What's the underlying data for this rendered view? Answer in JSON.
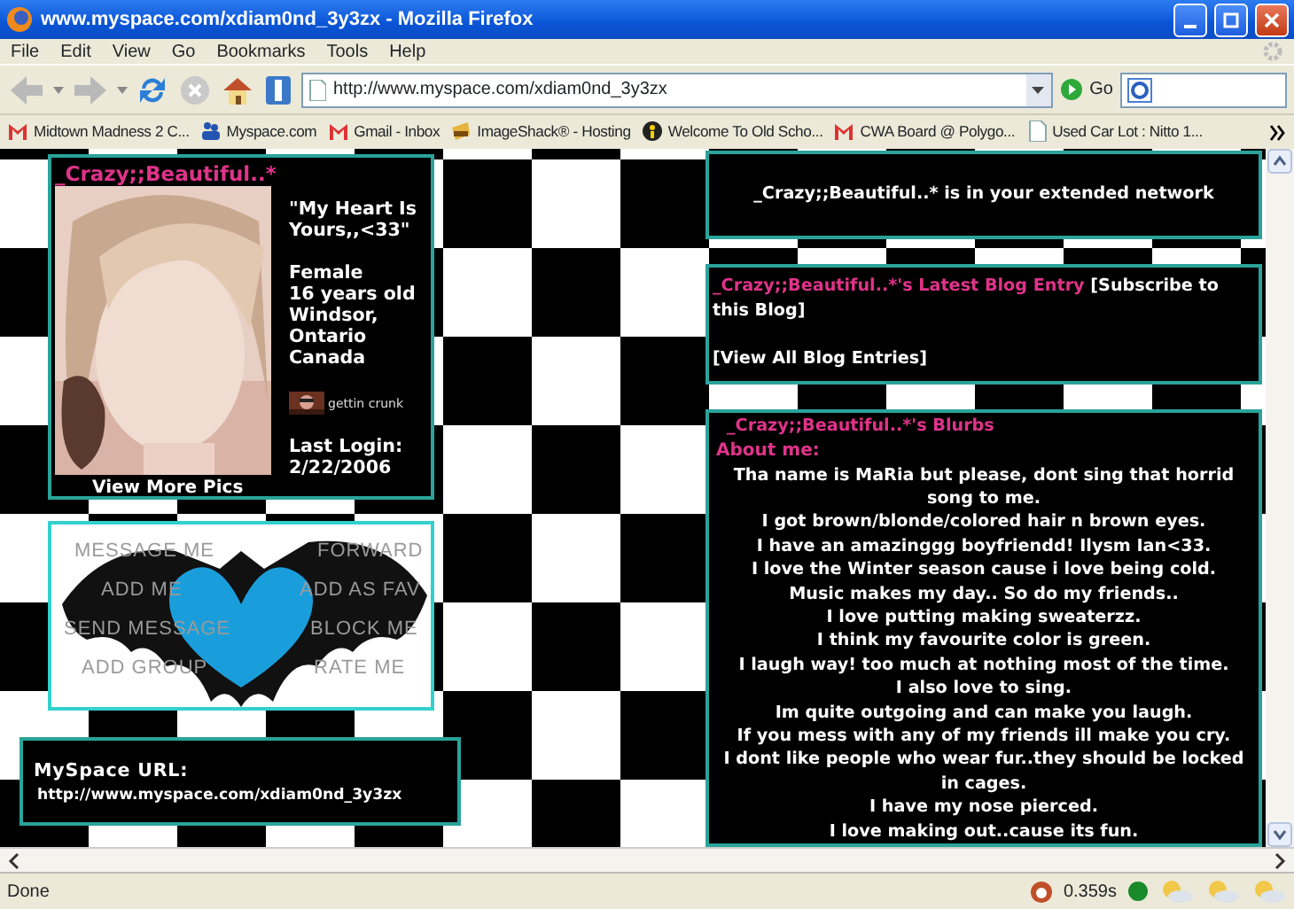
{
  "window": {
    "title": "www.myspace.com/xdiam0nd_3y3zx - Mozilla Firefox"
  },
  "menu": [
    "File",
    "Edit",
    "View",
    "Go",
    "Bookmarks",
    "Tools",
    "Help"
  ],
  "toolbar": {
    "url": "http://www.myspace.com/xdiam0nd_3y3zx",
    "go_label": "Go"
  },
  "bookmarks": [
    {
      "kind": "mail",
      "label": "Midtown Madness 2 C..."
    },
    {
      "kind": "people",
      "label": "Myspace.com"
    },
    {
      "kind": "mail",
      "label": "Gmail - Inbox"
    },
    {
      "kind": "shack",
      "label": "ImageShack® - Hosting"
    },
    {
      "kind": "figure",
      "label": "Welcome To Old Scho..."
    },
    {
      "kind": "mail",
      "label": "CWA Board @ Polygo..."
    },
    {
      "kind": "page",
      "label": "Used Car Lot : Nitto 1..."
    }
  ],
  "profile": {
    "name": "_Crazy;;Beautiful..*",
    "headline": "\"My Heart Is Yours,,<33\"",
    "details": [
      "Female",
      "16 years old",
      "Windsor,",
      "Ontario",
      "Canada"
    ],
    "mood": "gettin crunk",
    "last_login_label": "Last Login:",
    "last_login_date": "2/22/2006",
    "view_more": "View More Pics"
  },
  "contact": [
    {
      "label": "MESSAGE ME"
    },
    {
      "label": "FORWARD"
    },
    {
      "label": "ADD ME"
    },
    {
      "label": "ADD AS FAV"
    },
    {
      "label": "SEND MESSAGE"
    },
    {
      "label": "BLOCK ME"
    },
    {
      "label": "ADD GROUP"
    },
    {
      "label": "RATE ME"
    }
  ],
  "url_box": {
    "label": "MySpace URL:",
    "url": "http://www.myspace.com/xdiam0nd_3y3zx"
  },
  "network": {
    "text": "_Crazy;;Beautiful..* is in your extended network"
  },
  "blog": {
    "title": "_Crazy;;Beautiful..*'s Latest Blog Entry",
    "subscribe": "[Subscribe to this Blog]",
    "view_all": "[View All Blog Entries]"
  },
  "blurbs": {
    "title": "_Crazy;;Beautiful..*'s Blurbs",
    "about_label": "About me:",
    "lines": [
      "Tha name is MaRia but please, dont sing that horrid song to me.",
      "I got brown/blonde/colored hair n brown eyes.",
      "I have an amazinggg boyfriendd! Ilysm Ian<33.",
      "I love the Winter season cause i love being cold.",
      "Music makes my day.. So do my friends..",
      "I love putting making sweaterzz.",
      "I think my favourite color is green.",
      "I laugh way! too much at nothing most of the time.",
      "I also love to sing.",
      "Im quite outgoing and can make you laugh.",
      "If you mess with any of my friends ill make you cry.",
      "I dont like people who wear fur..they should be locked in cages.",
      "I have my nose pierced.",
      "I love making out..cause its fun."
    ]
  },
  "status_bar": {
    "text": "Done",
    "timing": "0.359s"
  }
}
